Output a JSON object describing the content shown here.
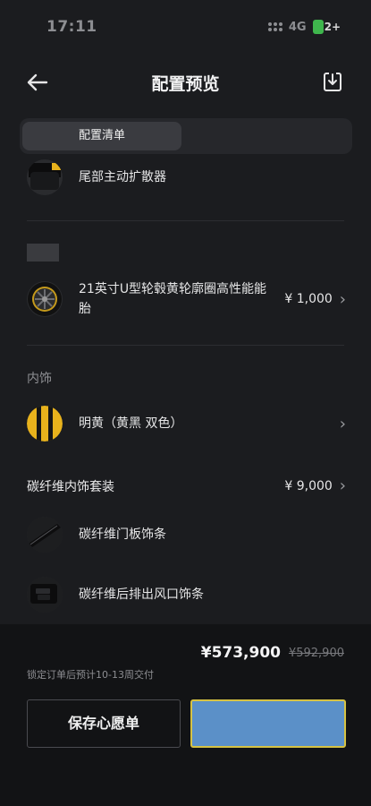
{
  "status_bar": {
    "time": "17:11",
    "network": "4G",
    "battery": "2+"
  },
  "nav": {
    "title": "配置预览"
  },
  "tabs": [
    {
      "label": "配置清单"
    }
  ],
  "items": [
    {
      "label": "尾部主动扩散器"
    },
    {
      "label": "21英寸U型轮毂黄轮廓圈高性能胎",
      "label_line1": "21英寸U型轮毂黄轮廓圈高性能能",
      "label_line2": "胎",
      "price": "¥ 1,000"
    },
    {
      "label": "明黄（黄黑 双色）"
    },
    {
      "label": "碳纤维门板饰条"
    },
    {
      "label": "碳纤维后排出风口饰条"
    }
  ],
  "sections": {
    "interior": "内饰",
    "carbon_package": {
      "label": "碳纤维内饰套装",
      "price": "¥ 9,000"
    }
  },
  "footer": {
    "total_price": "¥573,900",
    "original_price": "¥592,900",
    "delivery_note": "锁定订单后预计10-13周交付",
    "save_button": "保存心愿单",
    "primary_button": ""
  },
  "colors": {
    "accent_yellow": "#e8b21c",
    "primary_button": "#5b90c8",
    "button_border": "#d6c243"
  }
}
